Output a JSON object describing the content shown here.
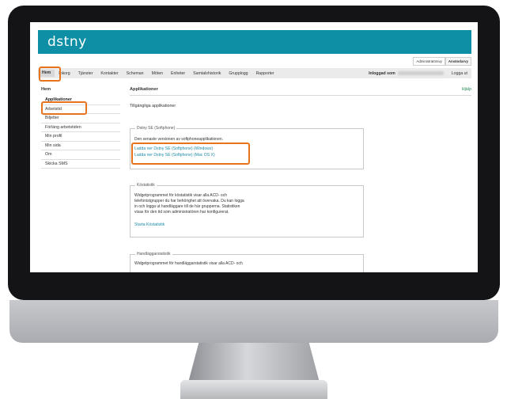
{
  "brand": {
    "logo_text": "dstny",
    "accent_color": "#0e8fa6",
    "highlight_color": "#e8731e"
  },
  "role_tabs": [
    "Administratörsvy",
    "Användarvy"
  ],
  "nav": {
    "items": [
      "Hem",
      "Inkorg",
      "Tjänster",
      "Kontakter",
      "Scheman",
      "Möten",
      "Enheter",
      "Samtalshistorik",
      "Grupplogg",
      "Rapporter"
    ],
    "logged_in_label": "Inloggad som",
    "logout_label": "Logga ut"
  },
  "sidebar": {
    "heading": "Hem",
    "items": [
      "Applikationer",
      "Arbetstid",
      "Biljetter",
      "Förläng arbetstiden",
      "Min profil",
      "Min sida",
      "Om",
      "Skicka SMS"
    ]
  },
  "main": {
    "title": "Applikationer",
    "help_label": "Hjälp",
    "subtitle": "Tillgängliga applikationer",
    "softphone": {
      "legend": "Dstny SE (Softphone)",
      "description": "Den senaste versionen av softphoneapplikationen.",
      "links": [
        "Ladda ner Dstny SE (Softphone) (Windows)",
        "Ladda ner Dstny SE (Softphone) (Mac OS X)"
      ]
    },
    "queue_stats": {
      "legend": "Köstatistik",
      "lines": [
        "Widgetprogrammet för köstatistik visar alla ACD- och",
        "telefonistgrupper du har behörighet att övervaka. Du kan logga",
        "in och logga ut handläggare till de här grupperna. Statistiken",
        "visas för den tid som administratören har konfigurerat."
      ],
      "link": "Starta Köstatistik"
    },
    "agent_stats": {
      "legend": "Handläggarstatistik",
      "lines": [
        "Widgetprogrammet för handläggarstatistik visar alla ACD- och"
      ]
    }
  }
}
